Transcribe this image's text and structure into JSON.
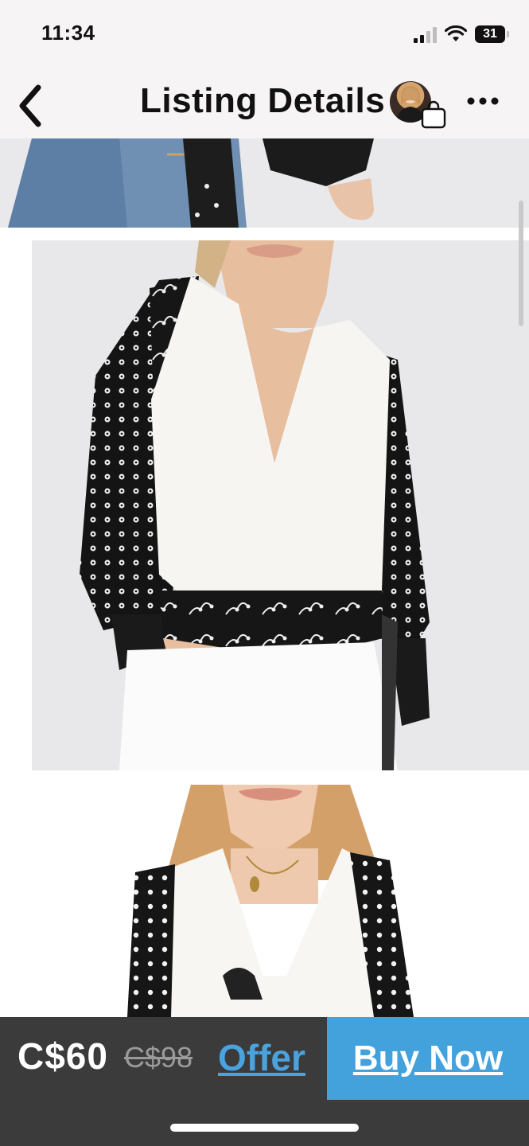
{
  "status_bar": {
    "time": "11:34",
    "battery": "31"
  },
  "nav": {
    "title": "Listing Details",
    "back_icon": "chevron-left-icon",
    "more_icon": "ellipsis-horizontal-icon",
    "seller_avatar_icon": "avatar",
    "bag_icon": "shopping-bag-icon"
  },
  "gallery": {
    "photos": [
      {
        "label": "photo-partial-top"
      },
      {
        "label": "photo-wrap-top-front"
      },
      {
        "label": "photo-wrap-top-model"
      }
    ]
  },
  "purchase_bar": {
    "price": "C$60",
    "original_price": "C$98",
    "offer_label": "Offer",
    "buy_label": "Buy Now",
    "accent_color": "#43a1dc",
    "bar_color": "#3b3b3b"
  }
}
